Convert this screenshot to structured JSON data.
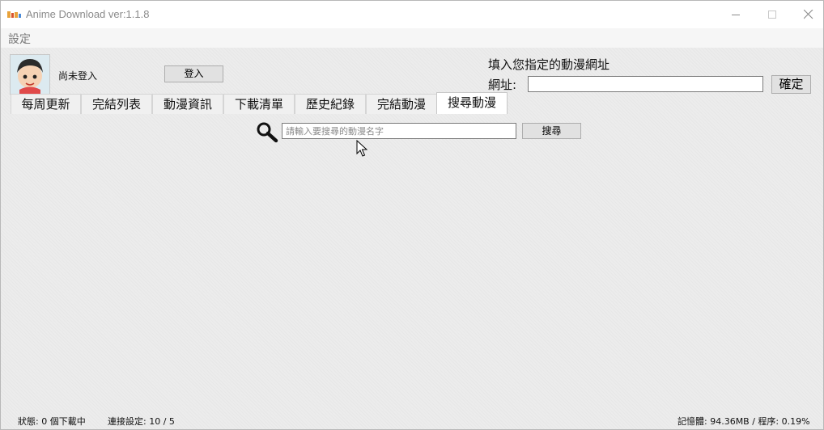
{
  "window": {
    "title": "Anime Download  ver:1.1.8",
    "controls": {
      "minimize": "minimize-icon",
      "maximize": "maximize-icon",
      "close": "close-icon"
    }
  },
  "menu": {
    "settings": "設定"
  },
  "account": {
    "status": "尚未登入",
    "login_button": "登入"
  },
  "url_section": {
    "heading": "填入您指定的動漫網址",
    "label": "網址:",
    "value": "",
    "confirm_button": "確定"
  },
  "tabs": [
    {
      "label": "每周更新"
    },
    {
      "label": "完結列表"
    },
    {
      "label": "動漫資訊"
    },
    {
      "label": "下載清單"
    },
    {
      "label": "歷史紀錄"
    },
    {
      "label": "完結動漫"
    },
    {
      "label": "搜尋動漫"
    }
  ],
  "active_tab": "搜尋動漫",
  "search": {
    "icon": "magnifier-icon",
    "placeholder": "請輸入要搜尋的動漫名字",
    "value": "",
    "button": "搜尋"
  },
  "status_bar": {
    "state": "狀態: 0 個下載中",
    "connection": "連接設定: 10 / 5",
    "resources": "記憶體: 94.36MB / 程序: 0.19%"
  },
  "colors": {
    "window_bg": "#ececec",
    "titlebar_bg": "#ffffff",
    "button_bg": "#e1e1e1",
    "button_border": "#adadad"
  }
}
